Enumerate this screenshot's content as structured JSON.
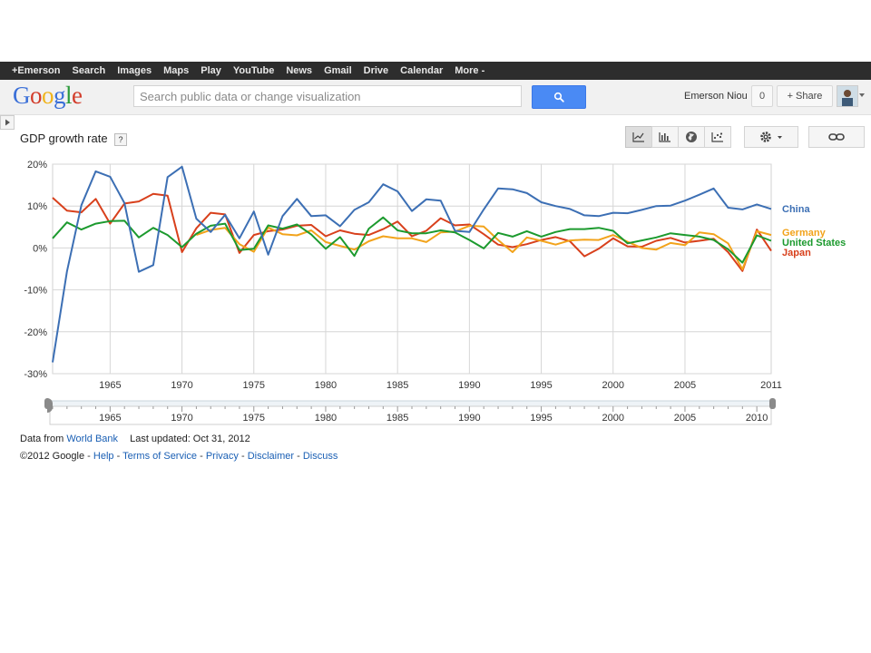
{
  "topbar": {
    "items": [
      "+Emerson",
      "Search",
      "Images",
      "Maps",
      "Play",
      "YouTube",
      "News",
      "Gmail",
      "Drive",
      "Calendar",
      "More -"
    ]
  },
  "header": {
    "logo_text": "Google",
    "search_placeholder": "Search public data or change visualization",
    "user_name": "Emerson Niou",
    "notification_count": "0",
    "share_label": "+ Share"
  },
  "chart_title": "GDP growth rate",
  "help_label": "?",
  "colors": {
    "china": "#3c6fb4",
    "germany": "#f2a31b",
    "united_states": "#1c9a2e",
    "japan": "#d8401c",
    "search_button": "#4a8af4"
  },
  "icons": {
    "line_chart": "line-chart-icon",
    "bar_chart": "bar-chart-icon",
    "map": "globe-icon",
    "scatter": "scatter-icon",
    "settings": "gear-icon",
    "link": "link-icon",
    "search": "search-icon"
  },
  "chart_data": {
    "type": "line",
    "title": "",
    "xlabel": "",
    "ylabel": "",
    "xlim": [
      1961,
      2011
    ],
    "ylim": [
      -30,
      20
    ],
    "yticks": [
      20,
      10,
      0,
      -10,
      -20,
      -30
    ],
    "ytick_labels": [
      "20%",
      "10%",
      "0%",
      "-10%",
      "-20%",
      "-30%"
    ],
    "xticks": [
      1965,
      1970,
      1975,
      1980,
      1985,
      1990,
      1995,
      2000,
      2005,
      2011
    ],
    "xtick_labels": [
      "1965",
      "1970",
      "1975",
      "1980",
      "1985",
      "1990",
      "1995",
      "2000",
      "2005",
      "2011"
    ],
    "grid": true,
    "x": [
      1961,
      1962,
      1963,
      1964,
      1965,
      1966,
      1967,
      1968,
      1969,
      1970,
      1971,
      1972,
      1973,
      1974,
      1975,
      1976,
      1977,
      1978,
      1979,
      1980,
      1981,
      1982,
      1983,
      1984,
      1985,
      1986,
      1987,
      1988,
      1989,
      1990,
      1991,
      1992,
      1993,
      1994,
      1995,
      1996,
      1997,
      1998,
      1999,
      2000,
      2001,
      2002,
      2003,
      2004,
      2005,
      2006,
      2007,
      2008,
      2009,
      2010,
      2011
    ],
    "series": [
      {
        "name": "China",
        "values": [
          -27.3,
          -5.6,
          10.2,
          18.3,
          17.0,
          10.7,
          -5.7,
          -4.1,
          16.9,
          19.4,
          7.0,
          3.8,
          7.9,
          2.3,
          8.7,
          -1.6,
          7.6,
          11.7,
          7.6,
          7.8,
          5.2,
          9.1,
          10.9,
          15.2,
          13.5,
          8.8,
          11.6,
          11.3,
          4.1,
          3.8,
          9.2,
          14.2,
          14.0,
          13.1,
          10.9,
          10.0,
          9.3,
          7.8,
          7.6,
          8.4,
          8.3,
          9.1,
          10.0,
          10.1,
          11.3,
          12.7,
          14.2,
          9.6,
          9.2,
          10.4,
          9.3
        ]
      },
      {
        "name": "Germany",
        "values": [
          null,
          null,
          null,
          null,
          null,
          null,
          null,
          null,
          null,
          null,
          3.1,
          4.3,
          4.8,
          0.9,
          -0.9,
          4.9,
          3.3,
          3.0,
          4.2,
          1.4,
          0.5,
          -0.4,
          1.6,
          2.8,
          2.3,
          2.3,
          1.4,
          3.7,
          3.9,
          5.3,
          5.1,
          1.9,
          -1.0,
          2.5,
          1.7,
          0.8,
          1.8,
          2.0,
          1.9,
          3.1,
          1.5,
          0.0,
          -0.4,
          1.2,
          0.7,
          3.7,
          3.3,
          1.1,
          -5.1,
          4.0,
          3.1
        ]
      },
      {
        "name": "United States",
        "values": [
          2.3,
          6.1,
          4.4,
          5.8,
          6.4,
          6.5,
          2.5,
          4.8,
          3.1,
          0.2,
          3.4,
          5.3,
          5.8,
          -0.5,
          -0.2,
          5.4,
          4.6,
          5.6,
          3.2,
          -0.2,
          2.6,
          -1.9,
          4.6,
          7.3,
          4.2,
          3.5,
          3.5,
          4.2,
          3.7,
          1.9,
          -0.1,
          3.6,
          2.7,
          4.0,
          2.7,
          3.8,
          4.5,
          4.5,
          4.8,
          4.1,
          1.1,
          1.8,
          2.5,
          3.5,
          3.1,
          2.7,
          1.9,
          -0.3,
          -3.5,
          3.0,
          1.7
        ]
      },
      {
        "name": "Japan",
        "values": [
          12.0,
          8.9,
          8.5,
          11.7,
          5.8,
          10.6,
          11.1,
          12.9,
          12.5,
          -1.0,
          4.7,
          8.4,
          8.0,
          -1.2,
          3.1,
          4.0,
          4.4,
          5.3,
          5.5,
          2.8,
          4.2,
          3.4,
          3.1,
          4.5,
          6.3,
          2.8,
          4.1,
          7.1,
          5.4,
          5.6,
          3.3,
          0.8,
          0.2,
          0.9,
          1.9,
          2.6,
          1.6,
          -2.0,
          -0.2,
          2.3,
          0.4,
          0.3,
          1.7,
          2.4,
          1.3,
          1.7,
          2.2,
          -1.0,
          -5.5,
          4.4,
          -0.7
        ]
      }
    ],
    "legend": {
      "placement": "right",
      "entries": [
        "China",
        "Germany",
        "United States",
        "Japan"
      ]
    },
    "timeline": {
      "labels": [
        "1965",
        "1970",
        "1975",
        "1980",
        "1985",
        "1990",
        "1995",
        "2000",
        "2005",
        "2010"
      ]
    }
  },
  "footer": {
    "data_from_prefix": "Data from",
    "data_source": "World Bank",
    "last_updated": "Last updated: Oct 31, 2012",
    "copyright": "©2012 Google",
    "links": [
      "Help",
      "Terms of Service",
      "Privacy",
      "Disclaimer",
      "Discuss"
    ]
  }
}
